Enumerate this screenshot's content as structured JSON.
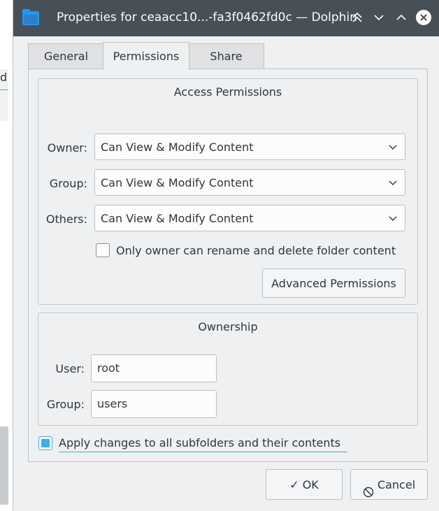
{
  "background": {
    "left_fragment_text": "d"
  },
  "window": {
    "title": "Properties for ceaacc10...-fa3f0462fd0c — Dolphin",
    "icon": "folder-icon",
    "buttons": {
      "keep_above": "⌃⌃",
      "minimize": "⌄",
      "maximize": "⌃",
      "close": "✕"
    }
  },
  "tabs": [
    {
      "label": "General"
    },
    {
      "label": "Permissions"
    },
    {
      "label": "Share"
    }
  ],
  "access_permissions": {
    "title": "Access Permissions",
    "owner_label": "Owner:",
    "owner_value": "Can View & Modify Content",
    "group_label": "Group:",
    "group_value": "Can View & Modify Content",
    "others_label": "Others:",
    "others_value": "Can View & Modify Content",
    "only_owner_label": "Only owner can rename and delete folder content",
    "only_owner_checked": false,
    "advanced_button": "Advanced Permissions"
  },
  "ownership": {
    "title": "Ownership",
    "user_label": "User:",
    "user_value": "root",
    "group_label": "Group:",
    "group_value": "users"
  },
  "apply_recursive": {
    "label": "Apply changes to all subfolders and their contents",
    "checked": true
  },
  "footer": {
    "ok_icon": "✓",
    "ok_label": "OK",
    "cancel_icon": "⃠",
    "cancel_label": "Cancel"
  },
  "colors": {
    "accent": "#3daee9",
    "titlebar": "#475057",
    "window_bg": "#eff0f1"
  }
}
